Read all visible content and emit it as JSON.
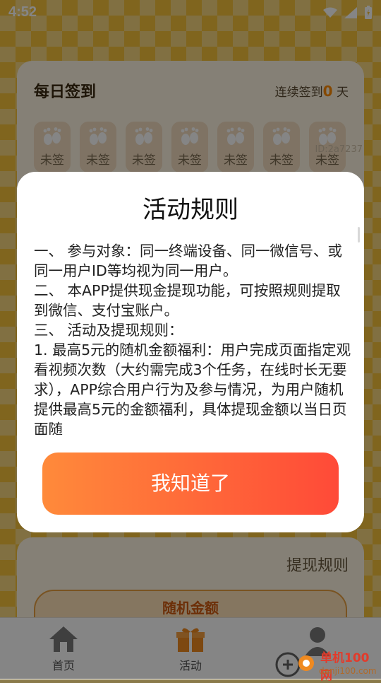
{
  "status_bar": {
    "time": "4:52"
  },
  "checkin": {
    "title": "每日签到",
    "streak_prefix": "连续签到",
    "streak_count": "0",
    "streak_suffix": "天",
    "days": [
      {
        "label": "未签"
      },
      {
        "label": "未签"
      },
      {
        "label": "未签"
      },
      {
        "label": "未签"
      },
      {
        "label": "未签"
      },
      {
        "label": "未签"
      },
      {
        "label": "未签"
      }
    ],
    "id_text": "ID:2a7237"
  },
  "withdraw": {
    "rules_link": "提现规则",
    "random_button": "随机金额"
  },
  "tabs": [
    {
      "label": "首页",
      "icon": "home-icon"
    },
    {
      "label": "活动",
      "icon": "gift-icon"
    },
    {
      "label": "",
      "icon": "profile-icon"
    }
  ],
  "modal": {
    "title": "活动规则",
    "paragraphs": [
      "一、 参与对象：同一终端设备、同一微信号、或同一用户ID等均视为同一用户。",
      " 二、 本APP提供现金提现功能，可按照规则提取到微信、支付宝账户。",
      " 三、 活动及提现规则：",
      " 1. 最高5元的随机金额福利：用户完成页面指定观看视频次数（大约需完成3个任务，在线时长无要求），APP综合用户行为及参与情况，为用户随机提供最高5元的金额福利，具体提现金额以当日页面随"
    ],
    "ok_button": "我知道了"
  },
  "watermark": {
    "line1": "单机100网",
    "line2": "danji100.com"
  },
  "colors": {
    "accent": "#ff8a00",
    "button_start": "#ff8a3a",
    "button_end": "#ff4a38"
  }
}
